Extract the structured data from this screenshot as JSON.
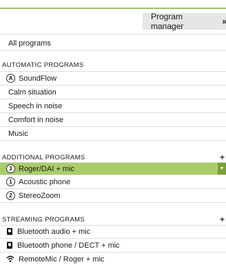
{
  "header": {
    "program_manager_label": "Program manager",
    "program_manager_icon": "double-chevron-right-icon"
  },
  "all_programs": {
    "label": "All programs"
  },
  "automatic": {
    "title": "AUTOMATIC PROGRAMS",
    "items": [
      {
        "label": "SoundFlow",
        "badge": "A"
      },
      {
        "label": "Calm situation"
      },
      {
        "label": "Speech in noise"
      },
      {
        "label": "Comfort in noise"
      },
      {
        "label": "Music"
      }
    ]
  },
  "additional": {
    "title": "ADDITIONAL PROGRAMS",
    "add_icon": "+",
    "items": [
      {
        "label": "Roger/DAI + mic",
        "badge": "3",
        "selected": true
      },
      {
        "label": "Acoustic phone",
        "badge": "1"
      },
      {
        "label": "StereoZoom",
        "badge": "2"
      }
    ]
  },
  "streaming": {
    "title": "STREAMING PROGRAMS",
    "add_icon": "+",
    "items": [
      {
        "label": "Bluetooth audio + mic",
        "icon": "device-icon"
      },
      {
        "label": "Bluetooth phone / DECT + mic",
        "icon": "device-icon"
      },
      {
        "label": "RemoteMic / Roger + mic",
        "icon": "wireless-icon"
      }
    ]
  },
  "colors": {
    "accent_green": "#9bc45b",
    "selected_row": "#a9cc6a",
    "selected_arrow": "#7a9e3a"
  }
}
